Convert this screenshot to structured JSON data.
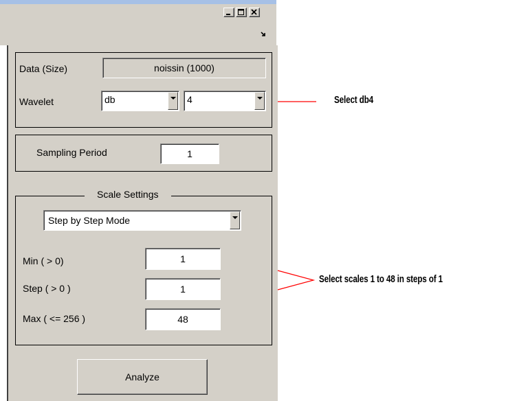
{
  "colors": {
    "window_bg": "#d4d0c8",
    "callout_line": "#ff0000",
    "text": "#000000"
  },
  "window": {
    "controls": [
      "minimize-icon",
      "maximize-icon",
      "close-icon"
    ],
    "dock_icon": "dock-arrow-icon"
  },
  "data_group": {
    "data_label": "Data  (Size)",
    "data_value": "noissin  (1000)",
    "wavelet_label": "Wavelet",
    "wavelet_family": "db",
    "wavelet_number": "4"
  },
  "sampling": {
    "label": "Sampling Period",
    "value": "1"
  },
  "scale": {
    "title": "Scale Settings",
    "mode": "Step by Step Mode",
    "min_label": "Min  ( > 0)",
    "min_value": "1",
    "step_label": "Step  ( > 0 )",
    "step_value": "1",
    "max_label": "Max  ( <= 256 )",
    "max_value": "48"
  },
  "analyze_label": "Analyze",
  "annotations": {
    "select_wavelet": "Select db4",
    "select_scales": "Select scales 1 to 48 in steps of 1"
  }
}
